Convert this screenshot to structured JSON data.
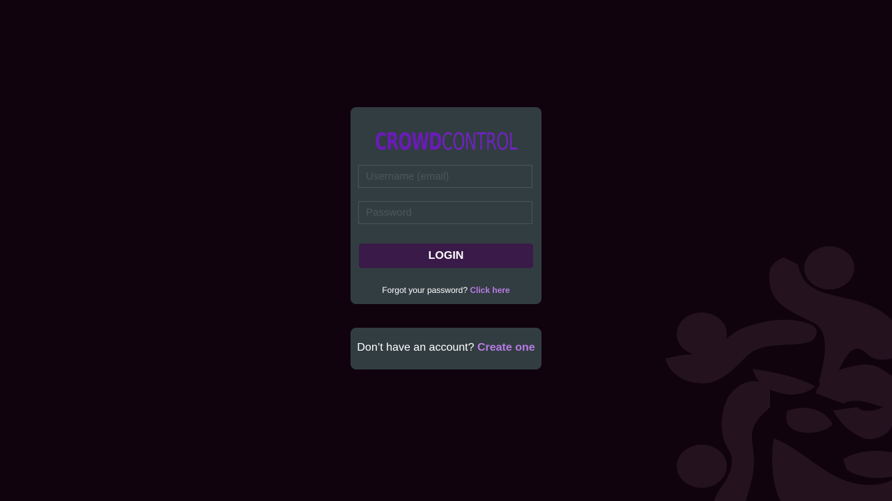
{
  "logo": {
    "part1": "CROWD",
    "part2": "CONTROL"
  },
  "login_form": {
    "username_placeholder": "Username (email)",
    "username_value": "",
    "password_placeholder": "Password",
    "password_value": "",
    "login_label": "LOGIN",
    "forgot_text": "Forgot your password?",
    "forgot_link": "Click here"
  },
  "signup": {
    "text": "Don’t have an account?",
    "link": "Create one"
  },
  "colors": {
    "background": "#10030d",
    "card": "#323d41",
    "brand_purple": "#6a1bb8",
    "button": "#3a1a48",
    "link": "#b77be4"
  },
  "icons": {
    "background_decoration": "crowd-figures-icon"
  }
}
